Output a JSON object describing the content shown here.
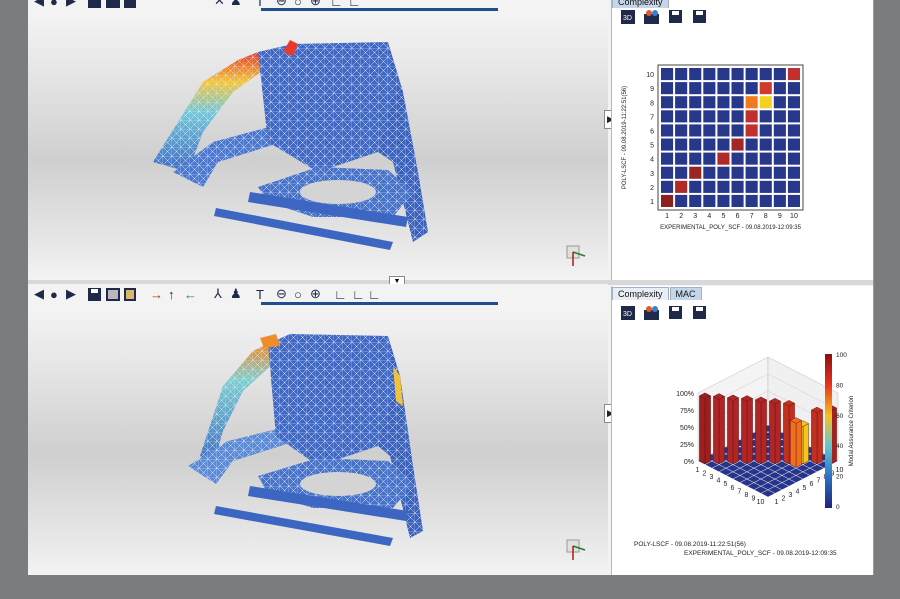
{
  "top_panel": {
    "tabs": [
      "Complexity"
    ],
    "matrix": {
      "rows": 10,
      "cols": 10,
      "ylabel": "POLY-LSCF - 09.08.2019-11:22:51(56)",
      "xlabel": "EXPERIMENTAL_POLY_SCF - 09.08.2019-12:09:35",
      "highlight_cells": [
        {
          "row": 1,
          "col": 1,
          "color": "#8b2020"
        },
        {
          "row": 2,
          "col": 2,
          "color": "#b02a2a"
        },
        {
          "row": 3,
          "col": 3,
          "color": "#9a2525"
        },
        {
          "row": 4,
          "col": 5,
          "color": "#b02a2a"
        },
        {
          "row": 5,
          "col": 6,
          "color": "#a02828"
        },
        {
          "row": 6,
          "col": 7,
          "color": "#c03030"
        },
        {
          "row": 7,
          "col": 7,
          "color": "#c03030"
        },
        {
          "row": 8,
          "col": 7,
          "color": "#f07a20"
        },
        {
          "row": 8,
          "col": 8,
          "color": "#f4d020"
        },
        {
          "row": 9,
          "col": 8,
          "color": "#d03a2a"
        },
        {
          "row": 10,
          "col": 10,
          "color": "#c03030"
        }
      ],
      "base_color": "#27378a"
    }
  },
  "bottom_panel": {
    "tabs": [
      "Complexity",
      "MAC"
    ],
    "active_tab": "MAC",
    "chart3d": {
      "z_ticks": [
        "100%",
        "75%",
        "50%",
        "25%",
        "0%"
      ],
      "axis_ticks": [
        "1",
        "2",
        "3",
        "4",
        "5",
        "6",
        "7",
        "8",
        "9",
        "10"
      ],
      "label_left": "POLY-LSCF - 09.08.2019-11:22:51(56)",
      "label_right": "EXPERIMENTAL_POLY_SCF - 09.08.2019-12:09:35",
      "colorbar_title": "Modal Assurance Criterion",
      "colorbar_ticks": [
        "100",
        "80",
        "60",
        "40",
        "20",
        "0"
      ]
    }
  },
  "colors": {
    "accent": "#1e4e8c",
    "matrix_bg": "#ffffff"
  },
  "icons": {
    "top_toolbar": [
      "prev-icon",
      "play-icon",
      "next-icon",
      "save-icon",
      "film-icon",
      "film-stack-icon",
      "axes-icon",
      "people-icon",
      "text-icon",
      "minus-icon",
      "circle-icon",
      "plus-icon",
      "chart-icon",
      "chart-plus-icon"
    ],
    "bottom_toolbar": [
      "prev-icon",
      "play-icon",
      "next-icon",
      "save-icon",
      "film-icon",
      "film-stack-icon",
      "arrow-right-icon",
      "arrow-up-icon",
      "arrow-left-icon",
      "axes-icon",
      "people-icon",
      "text-icon",
      "minus-icon",
      "circle-icon",
      "plus-icon",
      "chart-icon",
      "chart-plus-icon"
    ]
  }
}
